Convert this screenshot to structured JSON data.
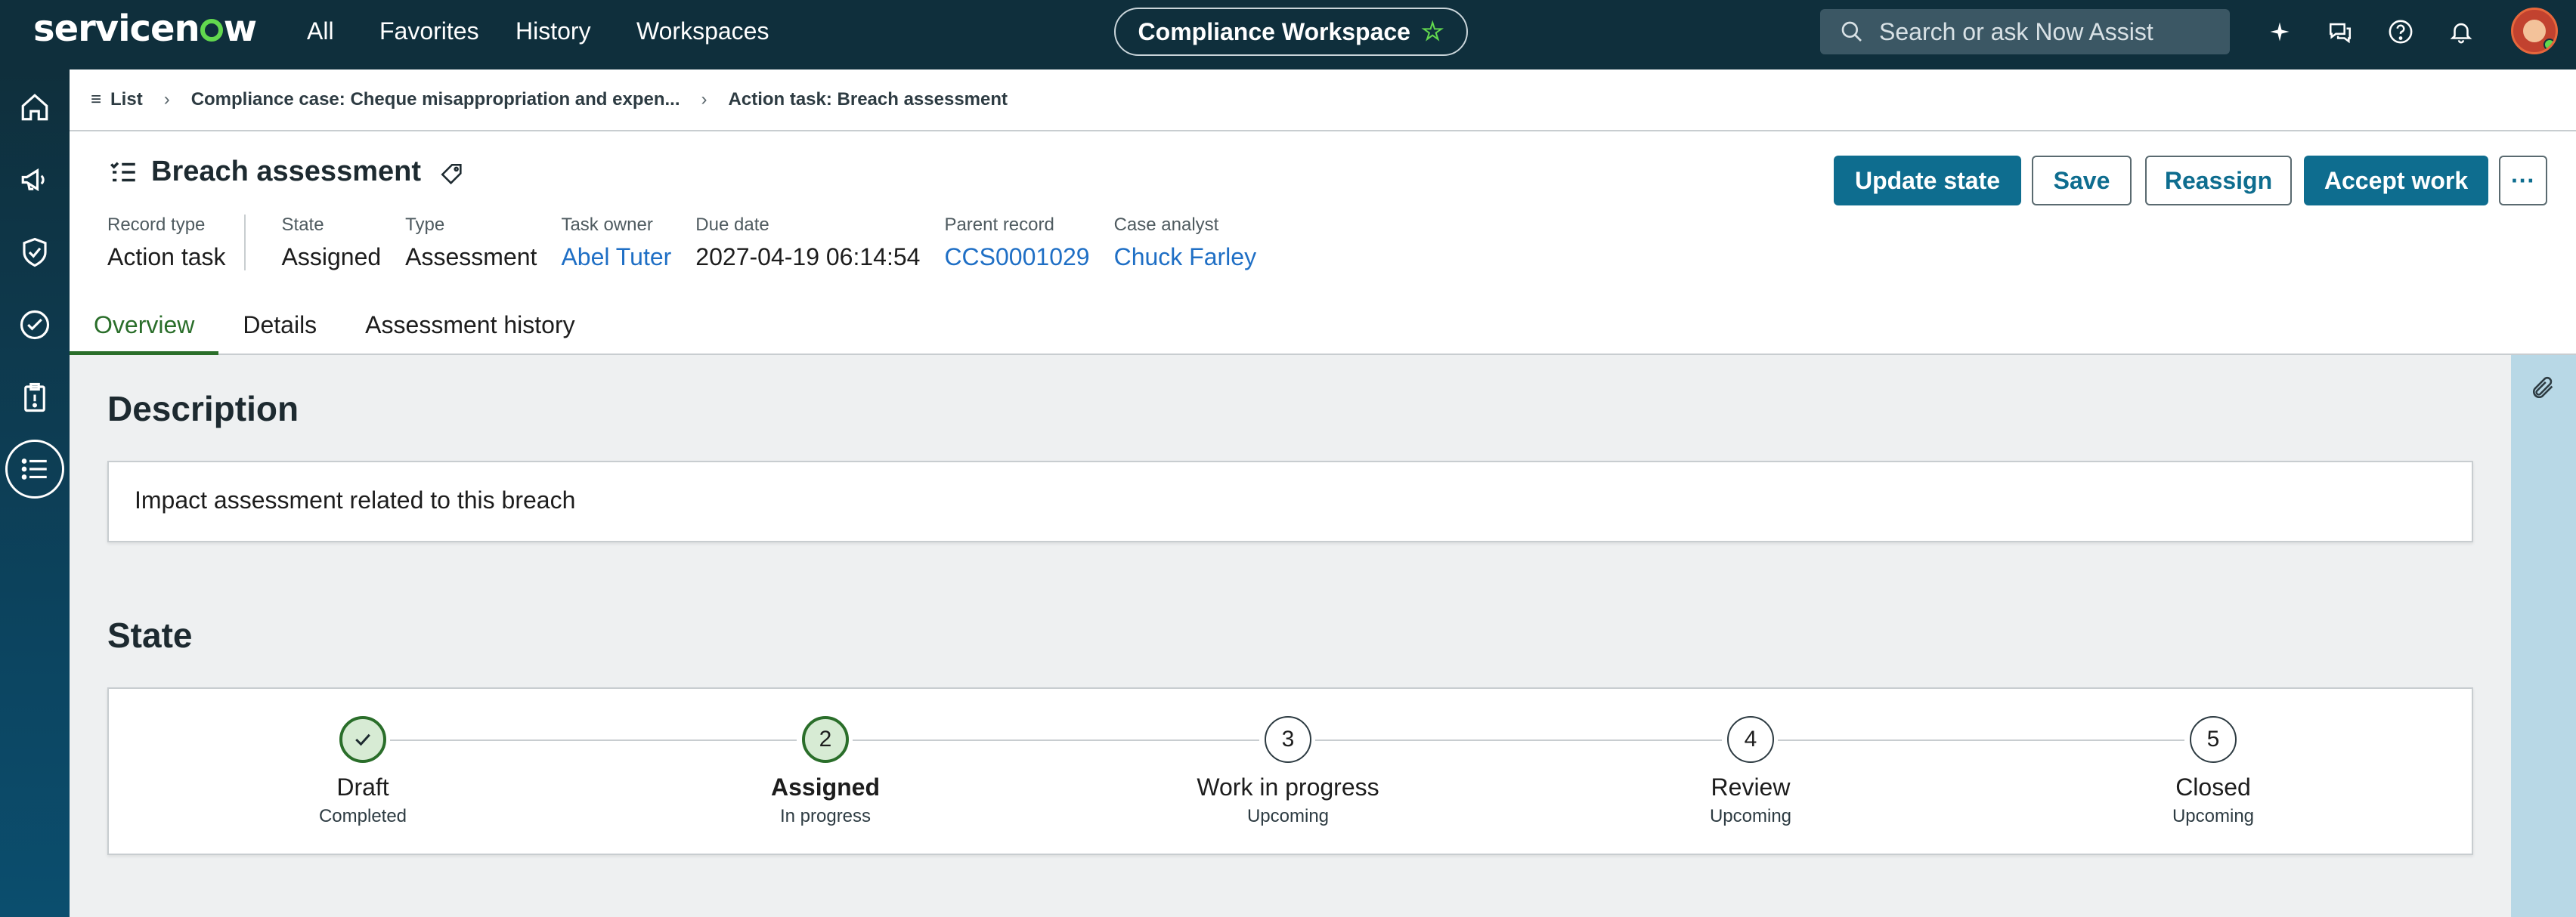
{
  "app": {
    "logo_left": "servicen",
    "logo_right": "w",
    "nav": [
      "All",
      "Favorites",
      "History",
      "Workspaces"
    ],
    "workspace": "Compliance Workspace",
    "search_placeholder": "Search or ask Now Assist"
  },
  "breadcrumb": {
    "list": "List",
    "case": "Compliance case: Cheque misappropriation and expen...",
    "current": "Action task: Breach assessment"
  },
  "record": {
    "title": "Breach assessment",
    "record_type_label": "Record type",
    "record_type": "Action task",
    "fields": [
      {
        "label": "State",
        "value": "Assigned",
        "link": false
      },
      {
        "label": "Type",
        "value": "Assessment",
        "link": false
      },
      {
        "label": "Task owner",
        "value": "Abel Tuter",
        "link": true
      },
      {
        "label": "Due date",
        "value": "2027-04-19 06:14:54",
        "link": false
      },
      {
        "label": "Parent record",
        "value": "CCS0001029",
        "link": true
      },
      {
        "label": "Case analyst",
        "value": "Chuck Farley",
        "link": true
      }
    ]
  },
  "actions": {
    "update_state": "Update state",
    "save": "Save",
    "reassign": "Reassign",
    "accept_work": "Accept work",
    "more": "···"
  },
  "tabs": [
    "Overview",
    "Details",
    "Assessment history"
  ],
  "description": {
    "title": "Description",
    "text": "Impact assessment related to this breach"
  },
  "state": {
    "title": "State",
    "steps": [
      {
        "num": "1",
        "name": "Draft",
        "status": "Completed",
        "kind": "done"
      },
      {
        "num": "2",
        "name": "Assigned",
        "status": "In progress",
        "kind": "current"
      },
      {
        "num": "3",
        "name": "Work in progress",
        "status": "Upcoming",
        "kind": "upcoming"
      },
      {
        "num": "4",
        "name": "Review",
        "status": "Upcoming",
        "kind": "upcoming"
      },
      {
        "num": "5",
        "name": "Closed",
        "status": "Upcoming",
        "kind": "upcoming"
      }
    ]
  },
  "colors": {
    "topbar": "#0f2f3c",
    "accent_green": "#62d84e",
    "primary_button": "#0e6d8f",
    "link": "#1f6fc5",
    "active_tab": "#2a6e2a"
  }
}
